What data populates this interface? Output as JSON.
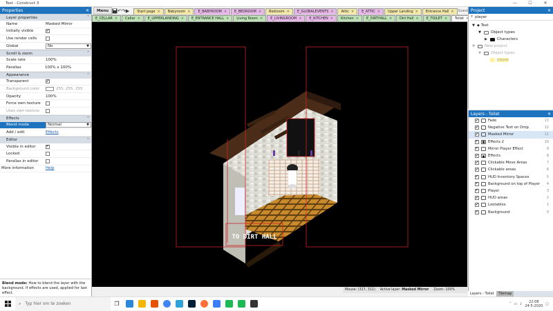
{
  "window": {
    "title": "Test - Construct 3",
    "min": "—",
    "max": "☐",
    "close": "✕"
  },
  "toolbar": {
    "menu_label": "Menu",
    "user": "Guest"
  },
  "tabs_row1": [
    {
      "label": "Start page",
      "color": "#f4e9a8"
    },
    {
      "label": "Babyroom",
      "color": "#f4e9a8"
    },
    {
      "label": "E_BABYROOM",
      "color": "#e8b8e8"
    },
    {
      "label": "E_BEDROOM",
      "color": "#e8b8e8"
    },
    {
      "label": "Bedroom",
      "color": "#f4e9a8"
    },
    {
      "label": "E_GLOBALEVENTS",
      "color": "#e8b8e8"
    },
    {
      "label": "Attic",
      "color": "#f4e9a8"
    },
    {
      "label": "E_ATTIC",
      "color": "#e8b8e8"
    },
    {
      "label": "Upper Landing",
      "color": "#f4e9a8"
    },
    {
      "label": "Entrance Hall",
      "color": "#f4e9a8"
    }
  ],
  "tabs_row2": [
    {
      "label": "E_CELLAR",
      "color": "#bce2b6"
    },
    {
      "label": "Cellar",
      "color": "#bce2b6"
    },
    {
      "label": "E_UPPERLANDING",
      "color": "#bce2b6"
    },
    {
      "label": "E_ENTRANCE HALL",
      "color": "#bce2b6"
    },
    {
      "label": "Living Room",
      "color": "#bce2b6"
    },
    {
      "label": "E_LIVINGROOM",
      "color": "#e8b8e8"
    },
    {
      "label": "E_KITCHEN",
      "color": "#e8b8e8"
    },
    {
      "label": "Kitchen",
      "color": "#bce2b6"
    },
    {
      "label": "E_DIRTHALL",
      "color": "#bce2b6"
    },
    {
      "label": "Dirt Hall",
      "color": "#bce2b6"
    },
    {
      "label": "E_TOILET",
      "color": "#bce2b6"
    },
    {
      "label": "Toilet",
      "color": "#ffffff"
    }
  ],
  "properties": {
    "title": "Properties",
    "sections": [
      {
        "header": "Layer properties",
        "rows": [
          {
            "key": "Name",
            "type": "text",
            "value": "Masked Mirror"
          },
          {
            "key": "Initially visible",
            "type": "check",
            "checked": true
          },
          {
            "key": "Use render cells",
            "type": "check",
            "checked": false
          },
          {
            "key": "Global",
            "type": "select",
            "value": "No"
          }
        ]
      },
      {
        "header": "Scroll & zoom",
        "rows": [
          {
            "key": "Scale rate",
            "type": "text",
            "value": "100%"
          },
          {
            "key": "Parallax",
            "type": "text",
            "value": "100% x 100%",
            "expand": true
          }
        ]
      },
      {
        "header": "Appearance",
        "rows": [
          {
            "key": "Transparent",
            "type": "check",
            "checked": true
          },
          {
            "key": "Background color",
            "type": "color",
            "value": "255, 255, 255",
            "disabled": true
          },
          {
            "key": "Opacity",
            "type": "text",
            "value": "100%"
          },
          {
            "key": "Force own texture",
            "type": "check",
            "checked": false
          },
          {
            "key": "Uses own texture",
            "type": "check",
            "checked": false,
            "disabled": true
          }
        ]
      },
      {
        "header": "Effects",
        "rows": [
          {
            "key": "Blend mode",
            "type": "select",
            "value": "Normal",
            "selected": true
          },
          {
            "key": "Add / edit",
            "type": "link",
            "value": "Effects"
          }
        ]
      },
      {
        "header": "Editor",
        "rows": [
          {
            "key": "Visible in editor",
            "type": "check",
            "checked": true
          },
          {
            "key": "Locked",
            "type": "check",
            "checked": false
          },
          {
            "key": "Parallax in editor",
            "type": "check",
            "checked": false
          }
        ]
      }
    ],
    "more_info": {
      "key": "More information",
      "value": "Help"
    },
    "desc_title": "Blend mode:",
    "desc_text": "How to blend the layer with the background. If effects are used, applied for last effect."
  },
  "canvas": {
    "button_text": "TO DIRT HALL",
    "status": {
      "mouse": "Mouse: (317, 311)",
      "active_layer_label": "Active layer:",
      "active_layer": "Masked Mirror",
      "zoom": "Zoom: 100%"
    }
  },
  "project": {
    "title": "Project",
    "search_value": "player",
    "tree": [
      {
        "label": "Test",
        "indent": 0,
        "arrow": "▼",
        "kind": "root",
        "dim": false
      },
      {
        "label": "Object types",
        "indent": 1,
        "arrow": "▼",
        "kind": "folder",
        "dim": false
      },
      {
        "label": "Characters",
        "indent": 2,
        "arrow": "▶",
        "kind": "folder-black",
        "dim": false
      },
      {
        "label": "New project",
        "indent": 0,
        "arrow": "▼",
        "kind": "folder",
        "dim": true
      },
      {
        "label": "Object types",
        "indent": 1,
        "arrow": "▼",
        "kind": "folder",
        "dim": true
      },
      {
        "label": "player",
        "indent": 2,
        "arrow": "",
        "kind": "sprite",
        "dim": true
      }
    ]
  },
  "layers": {
    "title": "Layers - Toilet",
    "items": [
      {
        "name": "Fade",
        "num": "13",
        "visible": true,
        "locked": false
      },
      {
        "name": "Negative Text on Drop",
        "num": "12",
        "visible": true,
        "locked": false
      },
      {
        "name": "Masked Mirror",
        "num": "11",
        "visible": true,
        "locked": false,
        "selected": true
      },
      {
        "name": "Effects 2",
        "num": "10",
        "visible": true,
        "locked": true
      },
      {
        "name": "Mirror Player Effect",
        "num": "9",
        "visible": true,
        "locked": false
      },
      {
        "name": "Effects",
        "num": "8",
        "visible": true,
        "locked": true
      },
      {
        "name": "Clickable Move Areas",
        "num": "7",
        "visible": true,
        "locked": false
      },
      {
        "name": "Clickable areas",
        "num": "6",
        "visible": true,
        "locked": false
      },
      {
        "name": "HUD Inventory Spaces",
        "num": "5",
        "visible": true,
        "locked": false
      },
      {
        "name": "Background on top of Player",
        "num": "4",
        "visible": true,
        "locked": false
      },
      {
        "name": "Player",
        "num": "3",
        "visible": true,
        "locked": false
      },
      {
        "name": "HUD areas",
        "num": "2",
        "visible": true,
        "locked": false
      },
      {
        "name": "Lootables",
        "num": "1",
        "visible": true,
        "locked": false
      },
      {
        "name": "Background",
        "num": "0",
        "visible": true,
        "locked": false
      }
    ],
    "tab_active": "Layers - Toilet",
    "tab_other": "Tilemap"
  },
  "taskbar": {
    "search_placeholder": "Typ hier om te zoeken",
    "time": "22:08",
    "date": "24-5-2020",
    "apps": [
      "#2b88d8",
      "#f4b400",
      "#e65100",
      "#4285f4",
      "#2fa2d9",
      "#001e36",
      "#ff7139",
      "#3d7eff",
      "#1db954",
      "#1db954",
      "#333333"
    ]
  },
  "colors": {
    "accent": "#1e73be",
    "canvas_bg": "#000000",
    "selection": "#d22"
  }
}
